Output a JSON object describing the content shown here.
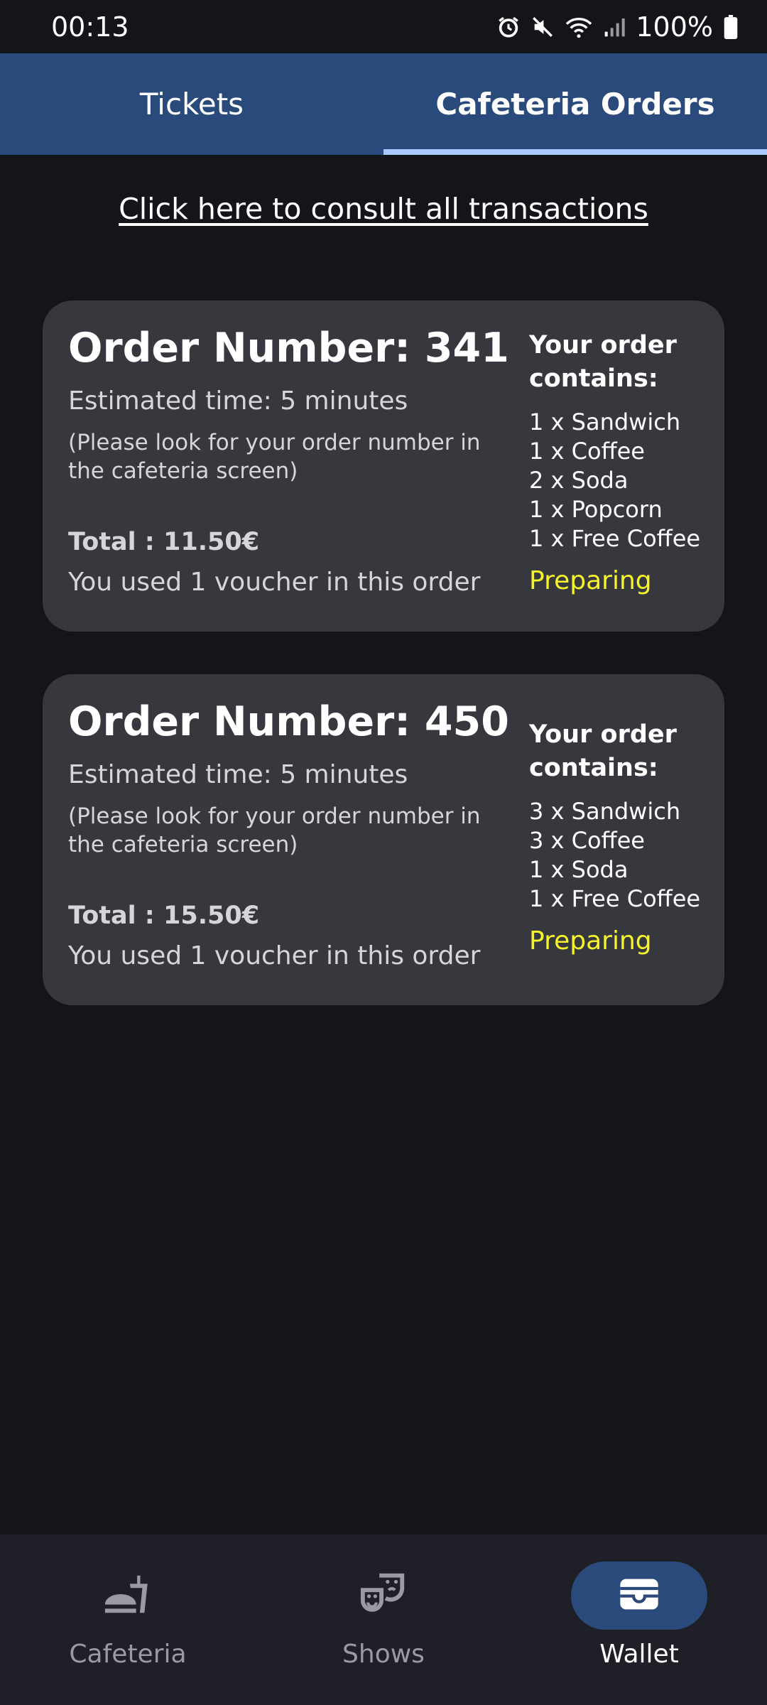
{
  "status_bar": {
    "time": "00:13",
    "battery": "100%",
    "icons": [
      "alarm-icon",
      "mute-icon",
      "wifi-icon",
      "signal-icon",
      "battery-icon"
    ]
  },
  "tabs": [
    {
      "label": "Tickets",
      "active": false
    },
    {
      "label": "Cafeteria Orders",
      "active": true
    }
  ],
  "consult_link": "Click here to consult all transactions",
  "orders": [
    {
      "title": "Order Number: 341",
      "estimated": "Estimated time: 5 minutes",
      "note": "(Please look for your order number in the cafeteria screen)",
      "total": "Total : 11.50€",
      "voucher": "You used 1 voucher in this order",
      "contains_title": "Your order contains:",
      "items": [
        "1 x Sandwich",
        "1 x Coffee",
        "2 x Soda",
        "1 x Popcorn",
        "1 x Free Coffee"
      ],
      "status": "Preparing"
    },
    {
      "title": "Order Number: 450",
      "estimated": "Estimated time: 5 minutes",
      "note": "(Please look for your order number in the cafeteria screen)",
      "total": "Total : 15.50€",
      "voucher": "You used 1 voucher in this order",
      "contains_title": "Your order contains:",
      "items": [
        "3 x Sandwich",
        "3 x Coffee",
        "1 x Soda",
        "1 x Free Coffee"
      ],
      "status": "Preparing"
    }
  ],
  "bottom_nav": [
    {
      "label": "Cafeteria",
      "icon": "fastfood-icon",
      "active": false
    },
    {
      "label": "Shows",
      "icon": "theater-masks-icon",
      "active": false
    },
    {
      "label": "Wallet",
      "icon": "wallet-icon",
      "active": true
    }
  ],
  "colors": {
    "background": "#141519",
    "header": "#2b4a7c",
    "tab_indicator": "#a8c8ff",
    "card": "#37383e",
    "status_preparing": "#f5f52a",
    "nav_background": "#1f2027"
  }
}
